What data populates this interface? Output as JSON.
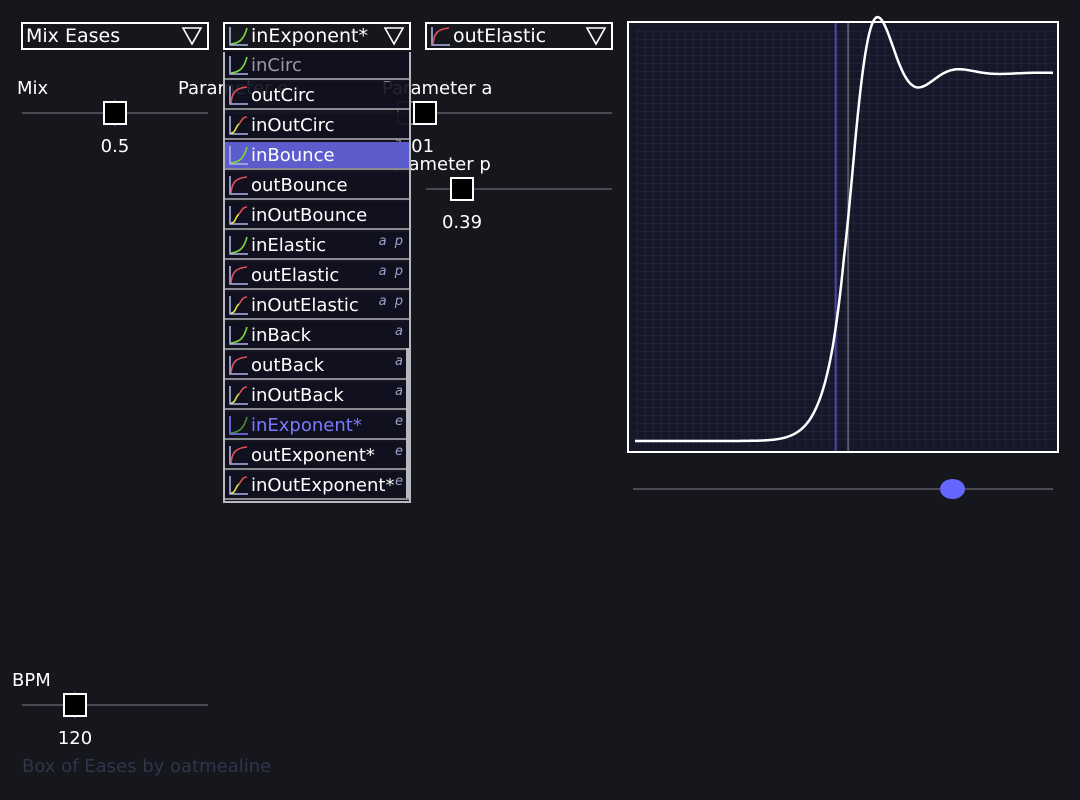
{
  "selects": {
    "mode": {
      "label": "Mix Eases"
    },
    "ease_a": {
      "label": "inExponent*",
      "icon": "ease-in-icon"
    },
    "ease_b": {
      "label": "outElastic",
      "icon": "ease-out-icon"
    }
  },
  "sliders": {
    "mix": {
      "label": "Mix",
      "value": "0.5",
      "fraction": 0.5
    },
    "param_e": {
      "label": "Parameter e",
      "value": "",
      "fraction": 0.5
    },
    "param_a": {
      "label": "Parameter a",
      "value": "1.01",
      "fraction": 0.0
    },
    "param_p": {
      "label": "Parameter p",
      "value": "0.39",
      "fraction": 0.2
    },
    "bpm": {
      "label": "BPM",
      "value": "120",
      "fraction": 0.29
    }
  },
  "dropdown": {
    "items": [
      {
        "label": "inCirc",
        "kind": "in",
        "hint": ""
      },
      {
        "label": "outCirc",
        "kind": "out",
        "hint": ""
      },
      {
        "label": "inOutCirc",
        "kind": "inout",
        "hint": ""
      },
      {
        "label": "inBounce",
        "kind": "in",
        "hint": "",
        "state": "hover"
      },
      {
        "label": "outBounce",
        "kind": "out",
        "hint": ""
      },
      {
        "label": "inOutBounce",
        "kind": "inout",
        "hint": ""
      },
      {
        "label": "inElastic",
        "kind": "in",
        "hint": "a p"
      },
      {
        "label": "outElastic",
        "kind": "out",
        "hint": "a p"
      },
      {
        "label": "inOutElastic",
        "kind": "inout",
        "hint": "a p"
      },
      {
        "label": "inBack",
        "kind": "in",
        "hint": "a"
      },
      {
        "label": "outBack",
        "kind": "out",
        "hint": "a"
      },
      {
        "label": "inOutBack",
        "kind": "inout",
        "hint": "a"
      },
      {
        "label": "inExponent*",
        "kind": "in-selected",
        "hint": "e",
        "state": "selected"
      },
      {
        "label": "outExponent*",
        "kind": "out",
        "hint": "e"
      },
      {
        "label": "inOutExponent*",
        "kind": "inout",
        "hint": "e"
      }
    ]
  },
  "graph": {
    "playhead_fraction": 0.48,
    "mix_marker_fraction": 0.51,
    "time_slider_fraction": 0.76
  },
  "colors": {
    "accent": "#6666ff",
    "hover": "#5c5ccc",
    "in_curve": "#7fd63a",
    "out_curve": "#e0505a",
    "inout_curve": "#e8e040",
    "axis": "#aab4e8"
  },
  "footer": {
    "credit": "Box of Eases by oatmealine"
  }
}
